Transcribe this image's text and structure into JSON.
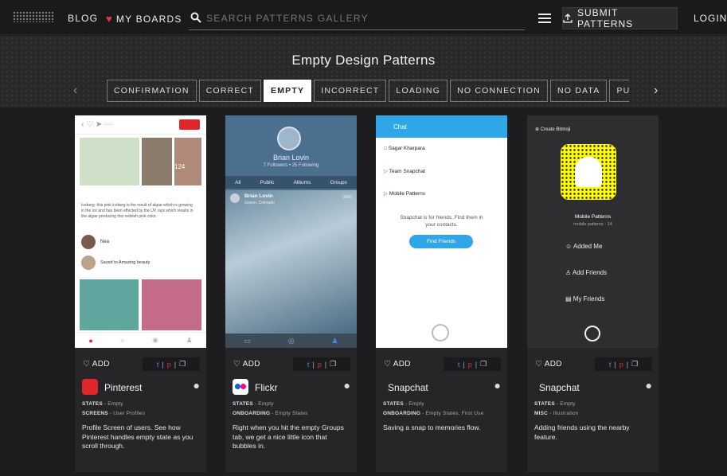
{
  "nav": {
    "blog": "BLOG",
    "boards": "MY BOARDS",
    "search_placeholder": "SEARCH PATTERNS GALLERY",
    "submit": "SUBMIT PATTERNS",
    "login": "LOGIN"
  },
  "page": {
    "title": "Empty Design Patterns"
  },
  "filters": [
    "CONFIRMATION",
    "CORRECT",
    "EMPTY",
    "INCORRECT",
    "LOADING",
    "NO CONNECTION",
    "NO DATA",
    "PULL TO REFRE"
  ],
  "active_filter": "EMPTY",
  "cards": [
    {
      "add": "ADD",
      "app": "Pinterest",
      "icon_color": "#e0262d",
      "tag1_label": "STATES",
      "tag1_value": "Empty",
      "tag2_label": "SCREENS",
      "tag2_value": "User Profiles",
      "desc": "Profile Screen of users. See how Pinterest handles empty state as you scroll through.",
      "screen": {
        "pin_text": "Iceberg: this pink iceberg is the result of algae which is growing in the ice and has been effected by the UV rays which results in the algae producing this reddish pink color.",
        "user": "Nea",
        "saved": "Saved to Amazing beauty",
        "count": "124"
      }
    },
    {
      "add": "ADD",
      "app": "Flickr",
      "icon_color": "#ffffff",
      "tag1_label": "STATES",
      "tag1_value": "Empty",
      "tag2_label": "ONBOARDING",
      "tag2_value": "Empty States",
      "desc": "Right when you hit the empty Groups tab, we get a nice little icon that bubbles in.",
      "screen": {
        "name": "Brian Lovin",
        "stats": "7 Followers • 25 Following",
        "tabs": [
          "All",
          "Public",
          "Albums",
          "Groups"
        ],
        "post_name": "Brian Lovin",
        "post_loc": "Gosen, Colorado",
        "post_time": "3mo"
      }
    },
    {
      "add": "ADD",
      "app": "Snapchat",
      "icon_color": "#fffc00",
      "tag1_label": "STATES",
      "tag1_value": "Empty",
      "tag2_label": "ONBOARDING",
      "tag2_value": "Empty States, First Use",
      "desc": "Saving a snap to memories flow.",
      "screen": {
        "header": "Chat",
        "rows": [
          "Sagar Kharpara",
          "Team Snapchat",
          "Mobile Patterns"
        ],
        "empty_text": "Snapchat is for friends. Find them in your contacts.",
        "cta": "Find Friends"
      }
    },
    {
      "add": "ADD",
      "app": "Snapchat",
      "icon_color": "#fffc00",
      "tag1_label": "STATES",
      "tag1_value": "Empty",
      "tag2_label": "MISC",
      "tag2_value": "Illustration",
      "desc": "Adding friends using the nearby feature.",
      "screen": {
        "create": "Create Bitmoji",
        "username": "Mobile Patterns",
        "handle": "mobile patterns · 14",
        "menu": [
          "Added Me",
          "Add Friends",
          "My Friends"
        ]
      }
    }
  ],
  "colors": {
    "accent": "#e0364a",
    "twitter": "#3e8be8",
    "pinterest": "#d8314d"
  }
}
